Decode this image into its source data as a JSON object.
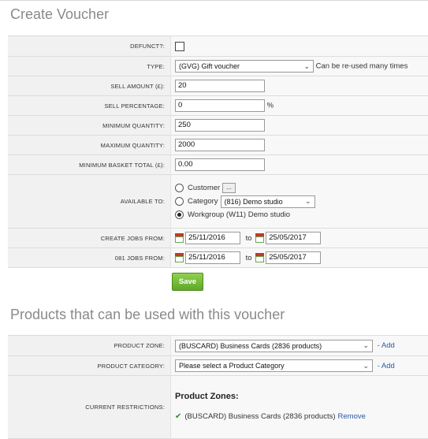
{
  "page": {
    "title": "Create Voucher"
  },
  "form": {
    "defunct": {
      "label": "DEFUNCT?:",
      "checked": false
    },
    "type": {
      "label": "TYPE:",
      "value": "(GVG) Gift voucher",
      "note": "Can be re-used many times"
    },
    "sell_amount": {
      "label": "SELL AMOUNT (£):",
      "value": "20"
    },
    "sell_percentage": {
      "label": "SELL PERCENTAGE:",
      "value": "0",
      "suffix": "%"
    },
    "min_quantity": {
      "label": "MINIMUM QUANTITY:",
      "value": "250"
    },
    "max_quantity": {
      "label": "MAXIMUM QUANTITY:",
      "value": "2000"
    },
    "min_basket": {
      "label": "MINIMUM BASKET TOTAL (£):",
      "value": "0.00"
    },
    "available_to": {
      "label": "AVAILABLE TO:",
      "customer_label": "Customer",
      "customer_button": "...",
      "category_label": "Category",
      "category_value": "(816) Demo studio",
      "workgroup_label": "Workgroup (W11) Demo studio",
      "selected": "workgroup"
    },
    "create_jobs": {
      "label": "CREATE JOBS FROM:",
      "from": "25/11/2016",
      "to_label": "to",
      "to": "25/05/2017"
    },
    "jobs_081": {
      "label": "081 JOBS FROM:",
      "from": "25/11/2016",
      "to_label": "to",
      "to": "25/05/2017"
    },
    "save_label": "Save"
  },
  "products": {
    "title": "Products that can be used with this voucher",
    "zone": {
      "label": "PRODUCT ZONE:",
      "value": "(BUSCARD)  Business Cards (2836 products)",
      "add": "- Add"
    },
    "category": {
      "label": "PRODUCT CATEGORY:",
      "value": "Please select a Product Category",
      "add": "- Add"
    },
    "restrictions": {
      "label": "CURRENT RESTRICTIONS:",
      "heading": "Product Zones:",
      "items": [
        {
          "text": "(BUSCARD)  Business Cards (2836 products)",
          "action": "Remove"
        }
      ]
    }
  },
  "colors": {
    "save_green": "#6cb533",
    "link_blue": "#2b5aa8",
    "tick_green": "#2e8b2e"
  }
}
